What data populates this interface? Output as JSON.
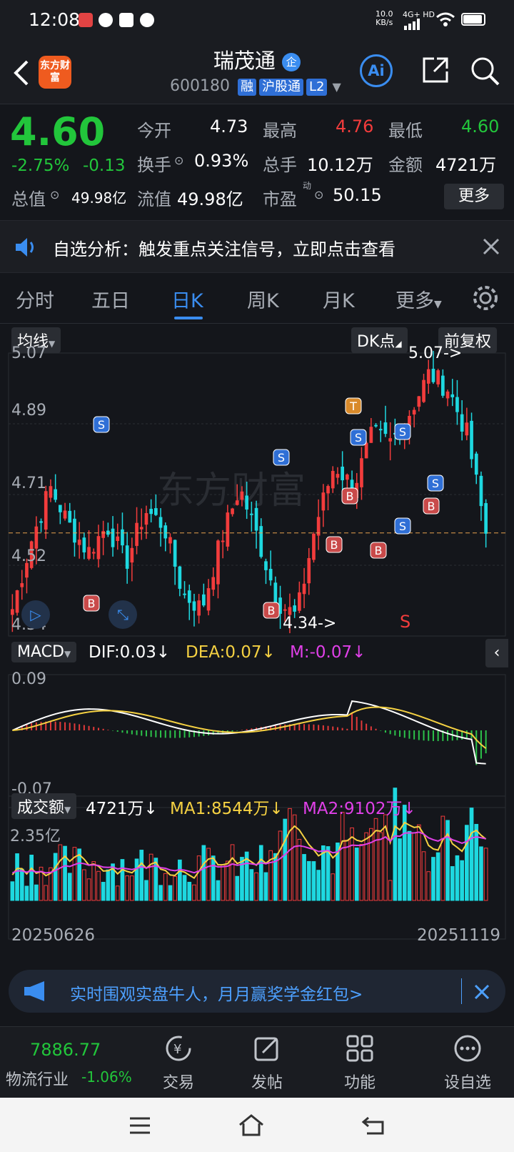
{
  "status_bar": {
    "time": "12:08",
    "net_speed_value": "10.0",
    "net_speed_unit": "KB/s",
    "network": "4G+ HD"
  },
  "header": {
    "logo_text": "东方财富",
    "stock_name": "瑞茂通",
    "enterprise_badge": "企",
    "stock_code": "600180",
    "tags": [
      "融",
      "沪股通",
      "L2"
    ]
  },
  "quote": {
    "price": "4.60",
    "change_pct": "-2.75%",
    "change": "-0.13",
    "open_label": "今开",
    "open": "4.73",
    "high_label": "最高",
    "high": "4.76",
    "low_label": "最低",
    "low": "4.60",
    "turnover_label": "换手",
    "turnover": "0.93%",
    "volume_label": "总手",
    "volume": "10.12万",
    "amount_label": "金额",
    "amount": "4721万",
    "mktcap_label": "总值",
    "mktcap": "49.98亿",
    "float_label": "流值",
    "float_cap": "49.98亿",
    "pe_label": "市盈",
    "pe_sup": "动",
    "pe": "50.15",
    "more_label": "更多"
  },
  "notice": {
    "text": "自选分析：触发重点关注信号，立即点击查看"
  },
  "tabs": [
    {
      "label": "分时"
    },
    {
      "label": "五日"
    },
    {
      "label": "日K"
    },
    {
      "label": "周K"
    },
    {
      "label": "月K"
    },
    {
      "label": "更多"
    }
  ],
  "kline": {
    "ma_selector": "均线",
    "dk_label": "DK点",
    "adjust_label": "前复权",
    "price_axis": [
      "5.07",
      "4.89",
      "4.71",
      "4.52",
      "4.34"
    ],
    "high_marker": "5.07->",
    "low_marker": "4.34->",
    "current_line": 4.6,
    "watermark": "东方财富",
    "signals": [
      {
        "text": "S"
      },
      {
        "text": "S"
      },
      {
        "text": "S"
      },
      {
        "text": "S"
      },
      {
        "text": "S"
      },
      {
        "text": "S"
      },
      {
        "text": "T"
      },
      {
        "text": "B"
      },
      {
        "text": "B"
      },
      {
        "text": "B"
      },
      {
        "text": "B"
      },
      {
        "text": "B"
      },
      {
        "text": "B"
      }
    ],
    "s_red": "S"
  },
  "macd": {
    "label": "MACD",
    "dif": "DIF:0.03↓",
    "dea": "DEA:0.07↓",
    "m": "M:-0.07↓",
    "axis_top": "0.09",
    "axis_bottom": "-0.07"
  },
  "volume": {
    "label": "成交额",
    "value": "4721万↓",
    "ma1": "MA1:8544万↓",
    "ma2": "MA2:9102万↓",
    "axis_top": "2.35亿",
    "date_start": "20250626",
    "date_end": "20251119"
  },
  "banner": {
    "text": "实时围观实盘牛人，月月赢奖学金红包>"
  },
  "bottom_bar": {
    "index_value": "7886.77",
    "index_name": "物流行业",
    "index_change": "-1.06%",
    "items": [
      {
        "label": "交易"
      },
      {
        "label": "发帖"
      },
      {
        "label": "功能"
      },
      {
        "label": "设自选"
      }
    ]
  },
  "colors": {
    "up": "#f23c3c",
    "down": "#1ed8e0",
    "accent": "#3a8df0",
    "fall_text": "#22c63b"
  }
}
